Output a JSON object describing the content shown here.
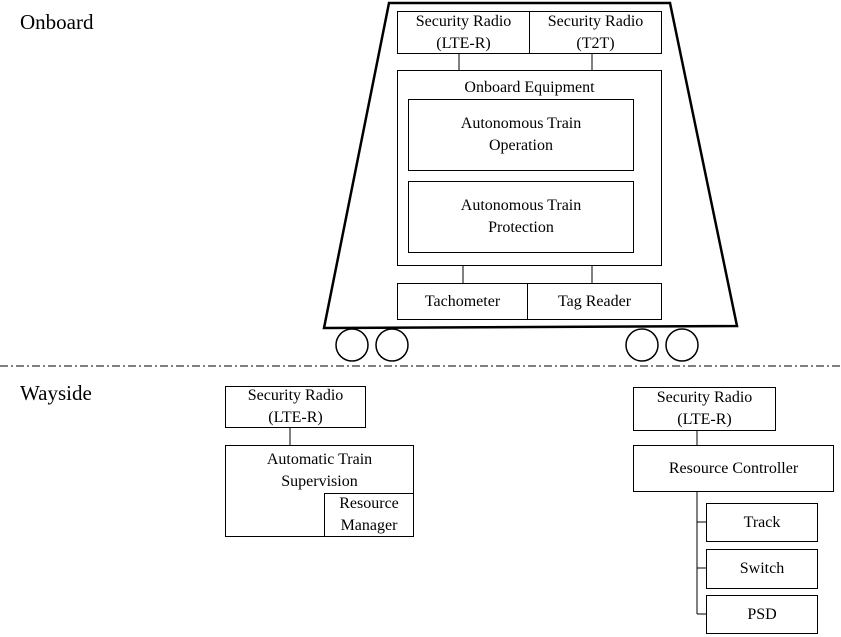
{
  "sections": {
    "onboard": "Onboard",
    "wayside": "Wayside"
  },
  "onboard": {
    "radio_lte": [
      "Security Radio",
      "(LTE-R)"
    ],
    "radio_t2t": [
      "Security Radio",
      "(T2T)"
    ],
    "equipment_title": "Onboard Equipment",
    "ato": [
      "Autonomous Train",
      "Operation"
    ],
    "atp": [
      "Autonomous Train",
      "Protection"
    ],
    "tachometer": "Tachometer",
    "tag_reader": "Tag Reader"
  },
  "wayside": {
    "left_radio": [
      "Security Radio",
      "(LTE-R)"
    ],
    "ats": [
      "Automatic Train",
      "Supervision"
    ],
    "resource_manager": [
      "Resource",
      "Manager"
    ],
    "right_radio": [
      "Security Radio",
      "(LTE-R)"
    ],
    "resource_controller": "Resource Controller",
    "track": "Track",
    "switch": "Switch",
    "psd": "PSD"
  }
}
